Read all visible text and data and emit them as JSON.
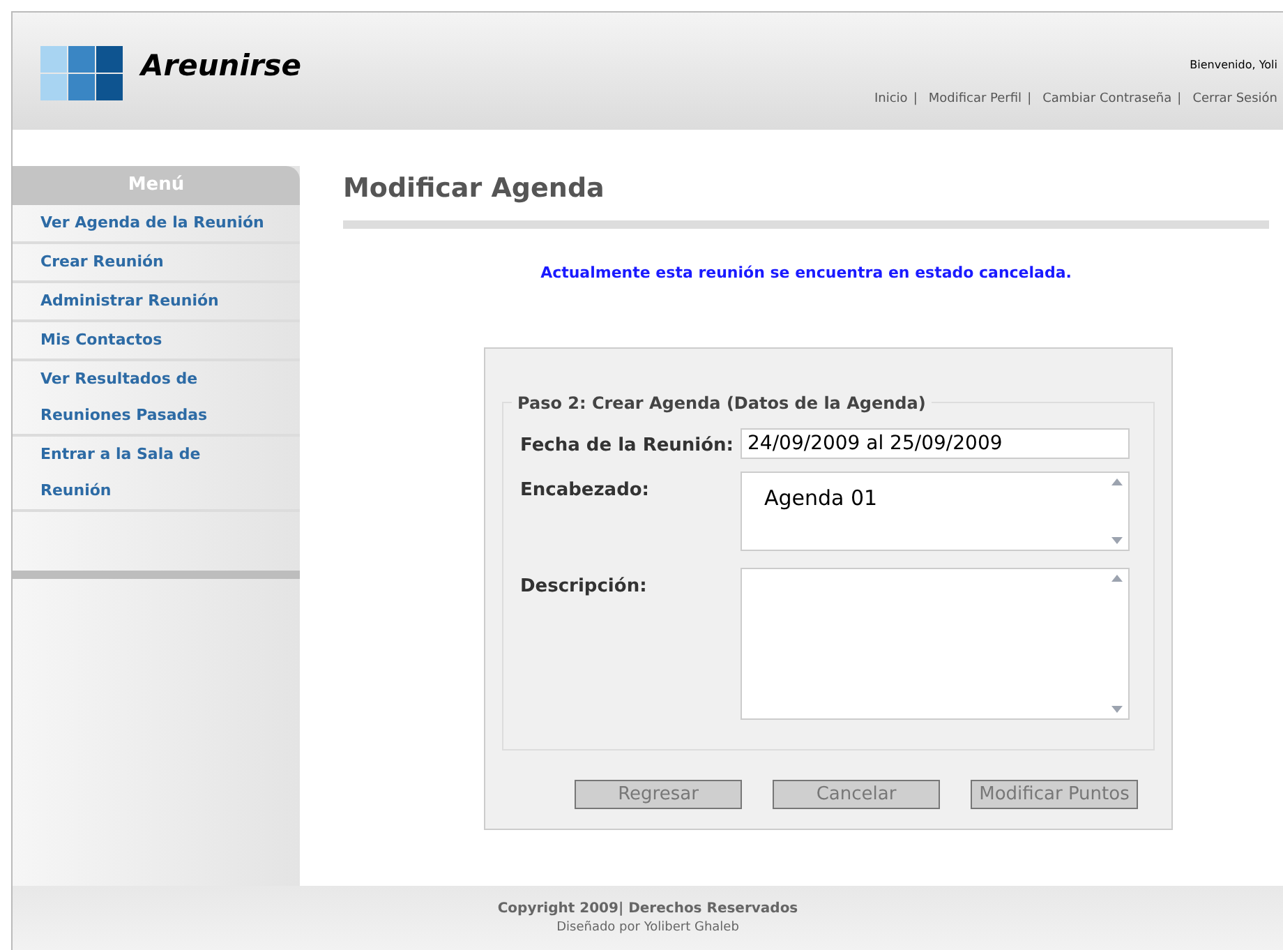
{
  "header": {
    "logo_text": "Areunirse",
    "greeting": "Bienvenido, Yoli",
    "nav": [
      {
        "label": "Inicio",
        "separator": "|"
      },
      {
        "label": "Modificar Perfil",
        "separator": "|"
      },
      {
        "label": "Cambiar Contraseña",
        "separator": "|"
      },
      {
        "label": "Cerrar Sesión"
      }
    ]
  },
  "sidebar": {
    "title": "Menú",
    "items": [
      {
        "lines": [
          "Ver Agenda de la Reunión"
        ]
      },
      {
        "lines": [
          "Crear Reunión"
        ]
      },
      {
        "lines": [
          "Administrar Reunión"
        ]
      },
      {
        "lines": [
          "Mis Contactos"
        ]
      },
      {
        "lines": [
          "Ver Resultados de",
          "Reuniones Pasadas"
        ]
      },
      {
        "lines": [
          "Entrar a la Sala de Reunión"
        ]
      }
    ]
  },
  "page_title": "Modificar Agenda",
  "status_message": "Actualmente esta reunión se encuentra en estado cancelada.",
  "form": {
    "legend": "Paso 2: Crear Agenda (Datos de la Agenda)",
    "fields": [
      {
        "kind": "input",
        "label": "Fecha de la Reunión:",
        "value": "24/09/2009 al 25/09/2009"
      },
      {
        "kind": "textarea",
        "label": "Encabezado:",
        "value": "Agenda 01"
      },
      {
        "kind": "textarea",
        "label": "Descripción:"
      }
    ],
    "buttons": [
      "Regresar",
      "Cancelar",
      "Modificar Puntos"
    ]
  },
  "footer": {
    "copyright": "Copyright 2009| Derechos Reservados",
    "credit": "Diseñado por Yolibert Ghaleb"
  }
}
